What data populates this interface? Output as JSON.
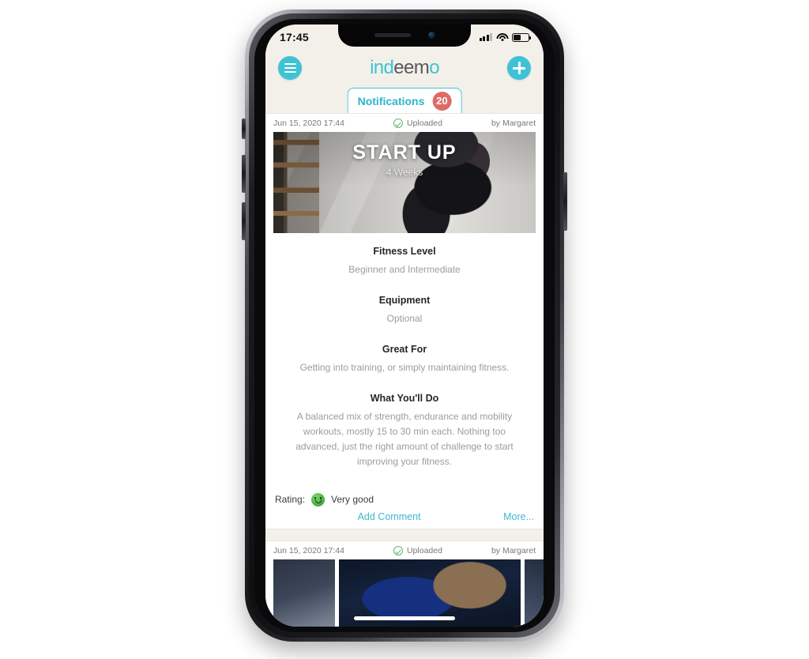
{
  "status_bar": {
    "time": "17:45",
    "signal_icon": "cellular-bars-icon",
    "wifi_icon": "wifi-icon",
    "battery_icon": "battery-icon"
  },
  "app_bar": {
    "menu_icon": "hamburger-menu-icon",
    "add_icon": "plus-icon",
    "logo_part1": "ind",
    "logo_part2": "eem",
    "logo_part3": "o",
    "accent_color": "#3ec3d6",
    "logo_dark_color": "#58595b",
    "background_color": "#f2f0e8"
  },
  "tab": {
    "label": "Notifications",
    "badge_count": "20",
    "badge_color": "#de6b65",
    "border_color": "#3ec3d6",
    "text_color": "#2fb4cb"
  },
  "posts": [
    {
      "date": "Jun 15, 2020 17:44",
      "status": "Uploaded",
      "status_icon": "check-circle-icon",
      "author": "by Margaret",
      "banner": {
        "title": "START UP",
        "subtitle": "4 Weeks"
      },
      "sections": [
        {
          "heading": "Fitness Level",
          "body": "Beginner and Intermediate"
        },
        {
          "heading": "Equipment",
          "body": "Optional"
        },
        {
          "heading": "Great For",
          "body": "Getting into training, or simply maintaining fitness."
        },
        {
          "heading": "What You'll Do",
          "body": "A balanced mix of strength, endurance and mobility workouts, mostly 15 to 30 min each. Nothing too advanced, just the right amount of challenge to start improving your fitness."
        }
      ],
      "rating": {
        "label": "Rating:",
        "icon": "green-smiley-icon",
        "value": "Very good"
      },
      "actions": {
        "add_comment": "Add Comment",
        "more": "More..."
      }
    },
    {
      "date": "Jun 15, 2020 17:44",
      "status": "Uploaded",
      "status_icon": "check-circle-icon",
      "author": "by Margaret"
    }
  ]
}
